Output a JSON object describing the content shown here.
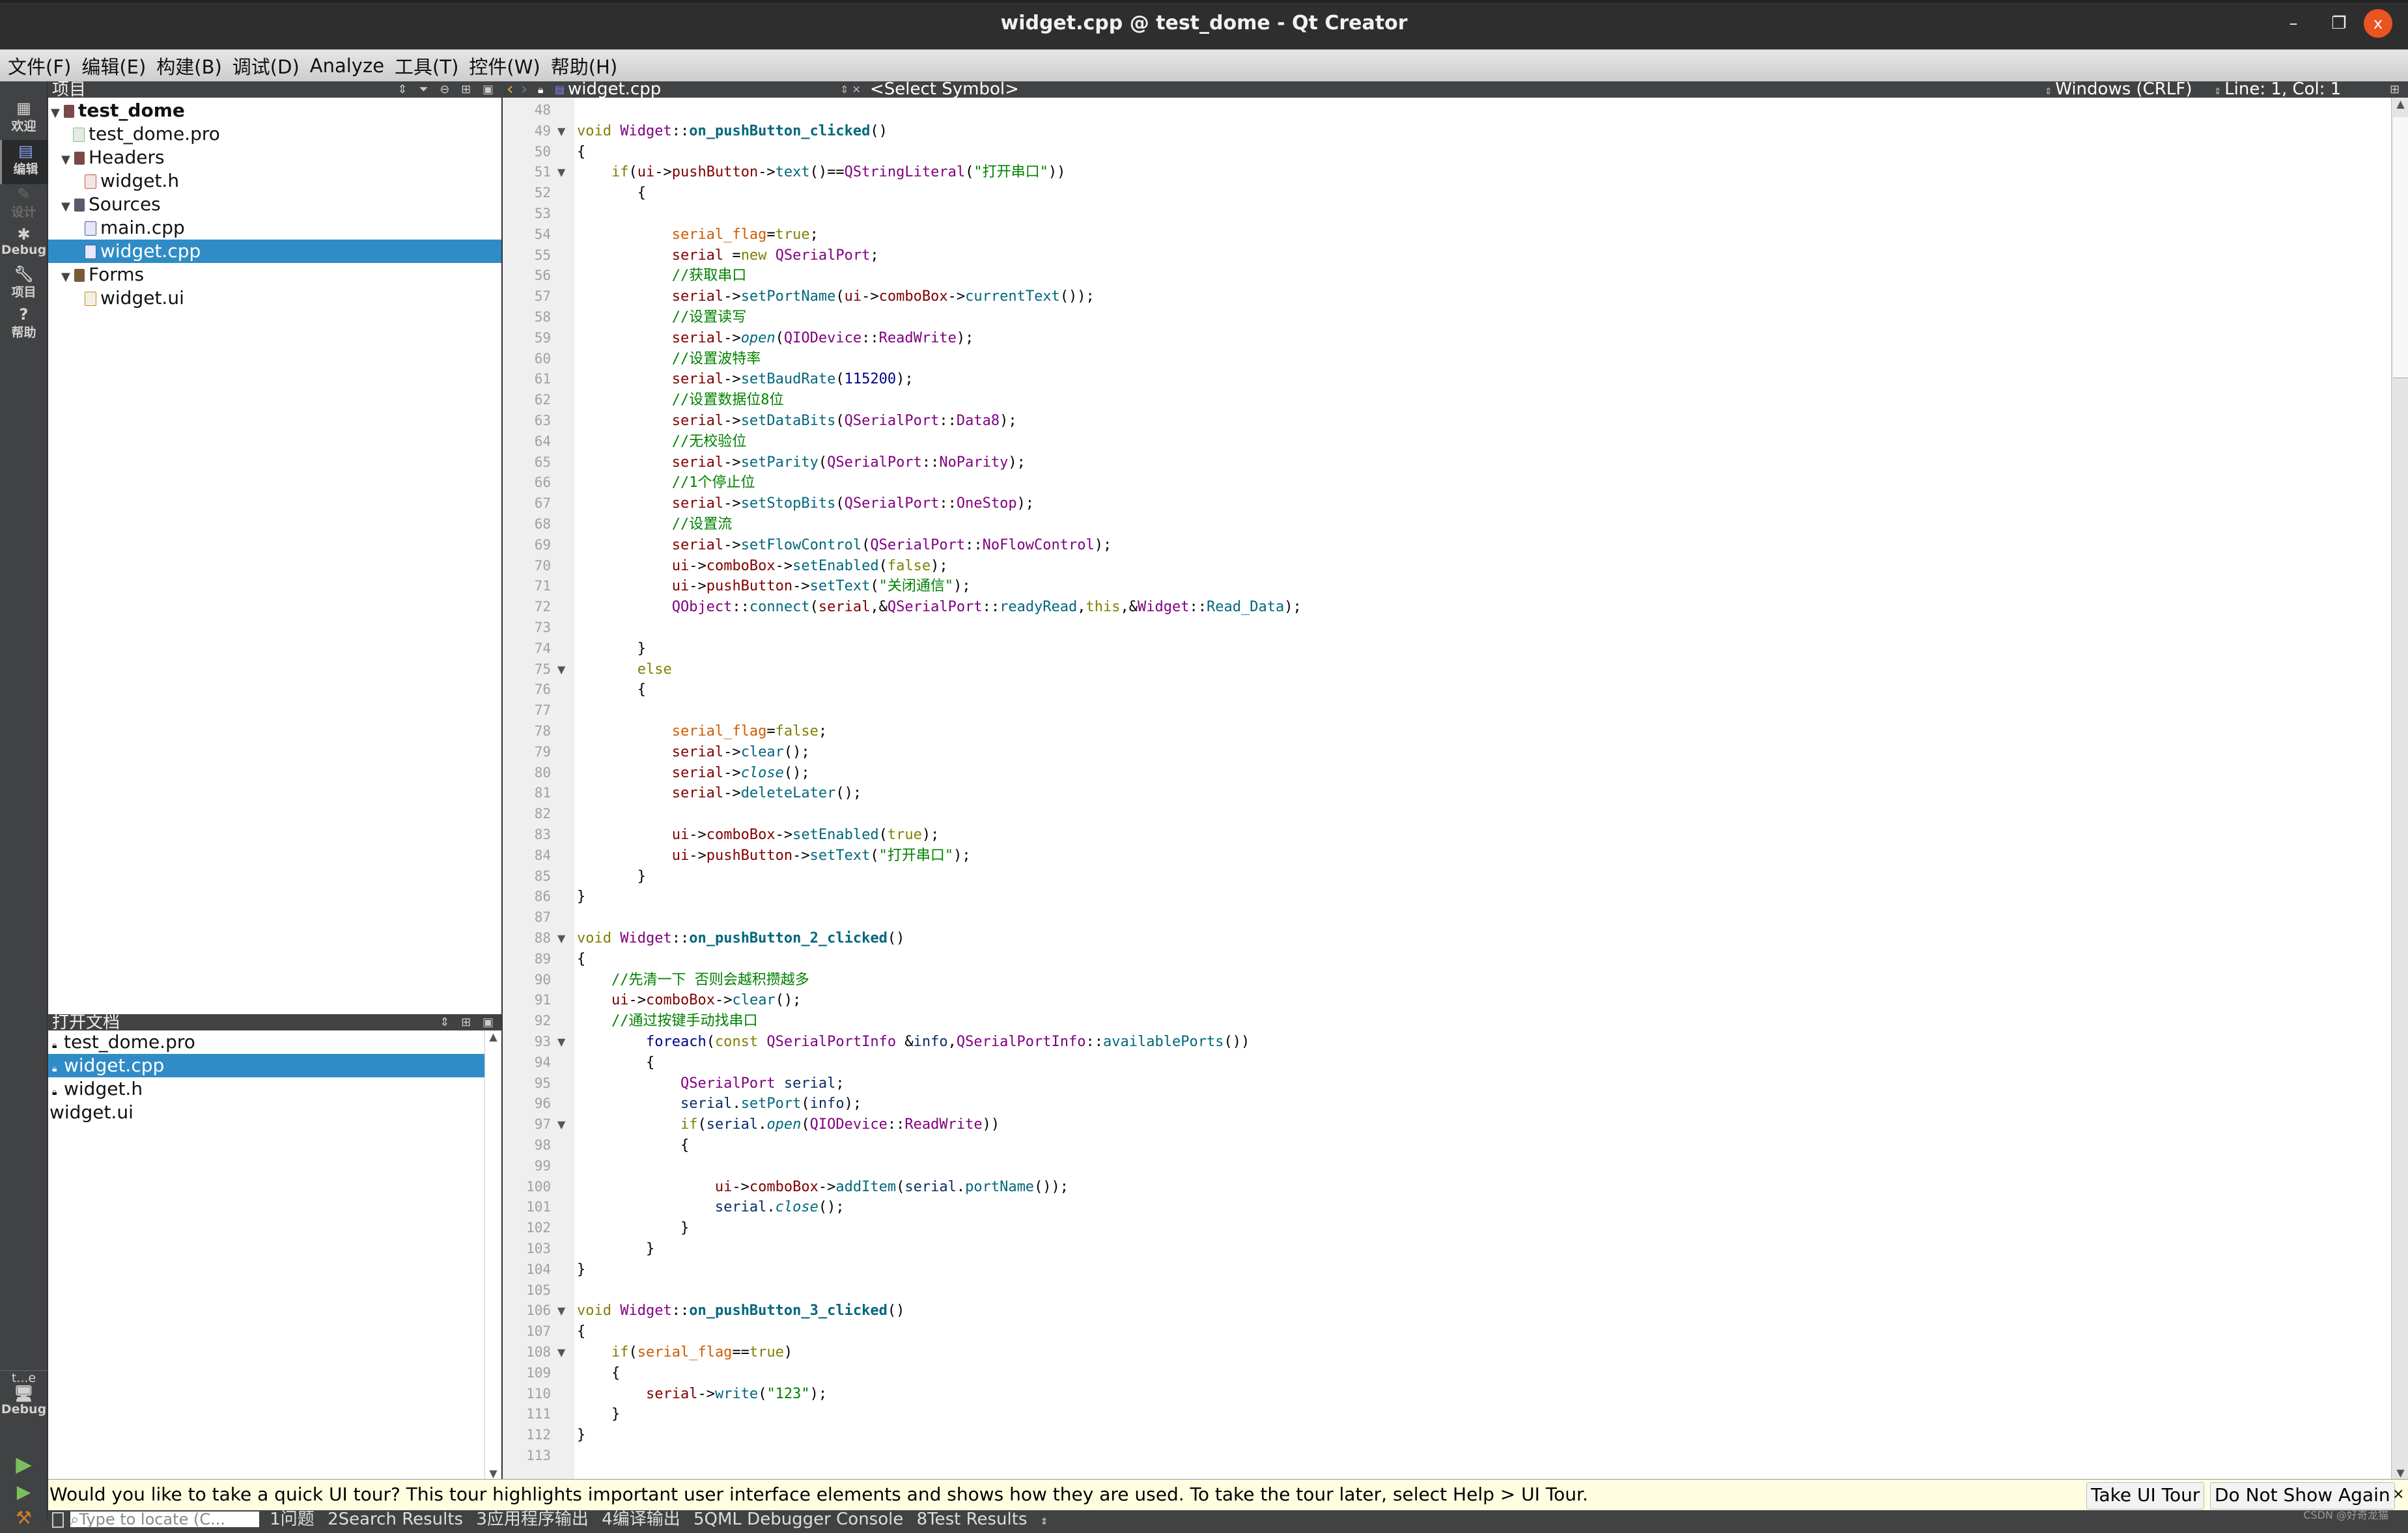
{
  "window": {
    "title": "widget.cpp @ test_dome - Qt Creator",
    "controls": {
      "minimize": "–",
      "maximize": "❐",
      "close": "x"
    }
  },
  "menu": [
    "文件(F)",
    "编辑(E)",
    "构建(B)",
    "调试(D)",
    "Analyze",
    "工具(T)",
    "控件(W)",
    "帮助(H)"
  ],
  "modes": [
    {
      "label": "欢迎",
      "icon": "grid-icon"
    },
    {
      "label": "编辑",
      "icon": "edit-doc-icon"
    },
    {
      "label": "设计",
      "icon": "pencil-icon"
    },
    {
      "label": "Debug",
      "icon": "bug-icon"
    },
    {
      "label": "项目",
      "icon": "wrench-icon"
    },
    {
      "label": "帮助",
      "icon": "help-icon"
    }
  ],
  "kit": {
    "project": "t...e",
    "config": "Debug"
  },
  "project_panel": {
    "title": "项目",
    "tree": [
      {
        "label": "test_dome",
        "depth": 0,
        "expanded": true,
        "bold": true,
        "kind": "project"
      },
      {
        "label": "test_dome.pro",
        "depth": 1,
        "kind": "pro"
      },
      {
        "label": "Headers",
        "depth": 1,
        "expanded": true,
        "kind": "folder-h"
      },
      {
        "label": "widget.h",
        "depth": 2,
        "kind": "h"
      },
      {
        "label": "Sources",
        "depth": 1,
        "expanded": true,
        "kind": "folder-cpp"
      },
      {
        "label": "main.cpp",
        "depth": 2,
        "kind": "cpp"
      },
      {
        "label": "widget.cpp",
        "depth": 2,
        "kind": "cpp",
        "selected": true
      },
      {
        "label": "Forms",
        "depth": 1,
        "expanded": true,
        "kind": "folder-ui"
      },
      {
        "label": "widget.ui",
        "depth": 2,
        "kind": "ui"
      }
    ]
  },
  "open_documents": {
    "title": "打开文档",
    "items": [
      {
        "label": "test_dome.pro",
        "locked": true
      },
      {
        "label": "widget.cpp",
        "locked": true,
        "selected": true
      },
      {
        "label": "widget.h",
        "locked": true
      },
      {
        "label": "widget.ui",
        "locked": false
      }
    ]
  },
  "editor": {
    "file": "widget.cpp",
    "symbol": "<Select Symbol>",
    "line_ending": "Windows (CRLF)",
    "position": "Line: 1, Col: 1",
    "first_line": 48,
    "folds": [
      49,
      51,
      75,
      88,
      93,
      97,
      106,
      108
    ],
    "lines": [
      "",
      "void Widget::on_pushButton_clicked()",
      "{",
      "    if(ui->pushButton->text()==QStringLiteral(\"打开串口\"))",
      "       {",
      "",
      "           serial_flag=true;",
      "           serial =new QSerialPort;",
      "           //获取串口",
      "           serial->setPortName(ui->comboBox->currentText());",
      "           //设置读写",
      "           serial->open(QIODevice::ReadWrite);",
      "           //设置波特率",
      "           serial->setBaudRate(115200);",
      "           //设置数据位8位",
      "           serial->setDataBits(QSerialPort::Data8);",
      "           //无校验位",
      "           serial->setParity(QSerialPort::NoParity);",
      "           //1个停止位",
      "           serial->setStopBits(QSerialPort::OneStop);",
      "           //设置流",
      "           serial->setFlowControl(QSerialPort::NoFlowControl);",
      "           ui->comboBox->setEnabled(false);",
      "           ui->pushButton->setText(\"关闭通信\");",
      "           QObject::connect(serial,&QSerialPort::readyRead,this,&Widget::Read_Data);",
      "",
      "       }",
      "       else",
      "       {",
      "",
      "           serial_flag=false;",
      "           serial->clear();",
      "           serial->close();",
      "           serial->deleteLater();",
      "",
      "           ui->comboBox->setEnabled(true);",
      "           ui->pushButton->setText(\"打开串口\");",
      "       }",
      "}",
      "",
      "void Widget::on_pushButton_2_clicked()",
      "{",
      "    //先清一下 否则会越积攒越多",
      "    ui->comboBox->clear();",
      "    //通过按键手动找串口",
      "        foreach(const QSerialPortInfo &info,QSerialPortInfo::availablePorts())",
      "        {",
      "            QSerialPort serial;",
      "            serial.setPort(info);",
      "            if(serial.open(QIODevice::ReadWrite))",
      "            {",
      "",
      "                ui->comboBox->addItem(serial.portName());",
      "                serial.close();",
      "            }",
      "        }",
      "}",
      "",
      "void Widget::on_pushButton_3_clicked()",
      "{",
      "    if(serial_flag==true)",
      "    {",
      "        serial->write(\"123\");",
      "    }",
      "}",
      ""
    ]
  },
  "info_bar": {
    "message": "Would you like to take a quick UI tour? This tour highlights important user interface elements and shows how they are used. To take the tour later, select Help > UI Tour.",
    "take_tour": "Take UI Tour",
    "dont_show": "Do Not Show Again",
    "close": "×"
  },
  "status_bar": {
    "locator_placeholder": "Type to locate (C...",
    "panes": [
      "1问题",
      "2Search Results",
      "3应用程序输出",
      "4编译输出",
      "5QML Debugger Console",
      "8Test Results"
    ],
    "watermark": "CSDN @好奇龙猫"
  }
}
